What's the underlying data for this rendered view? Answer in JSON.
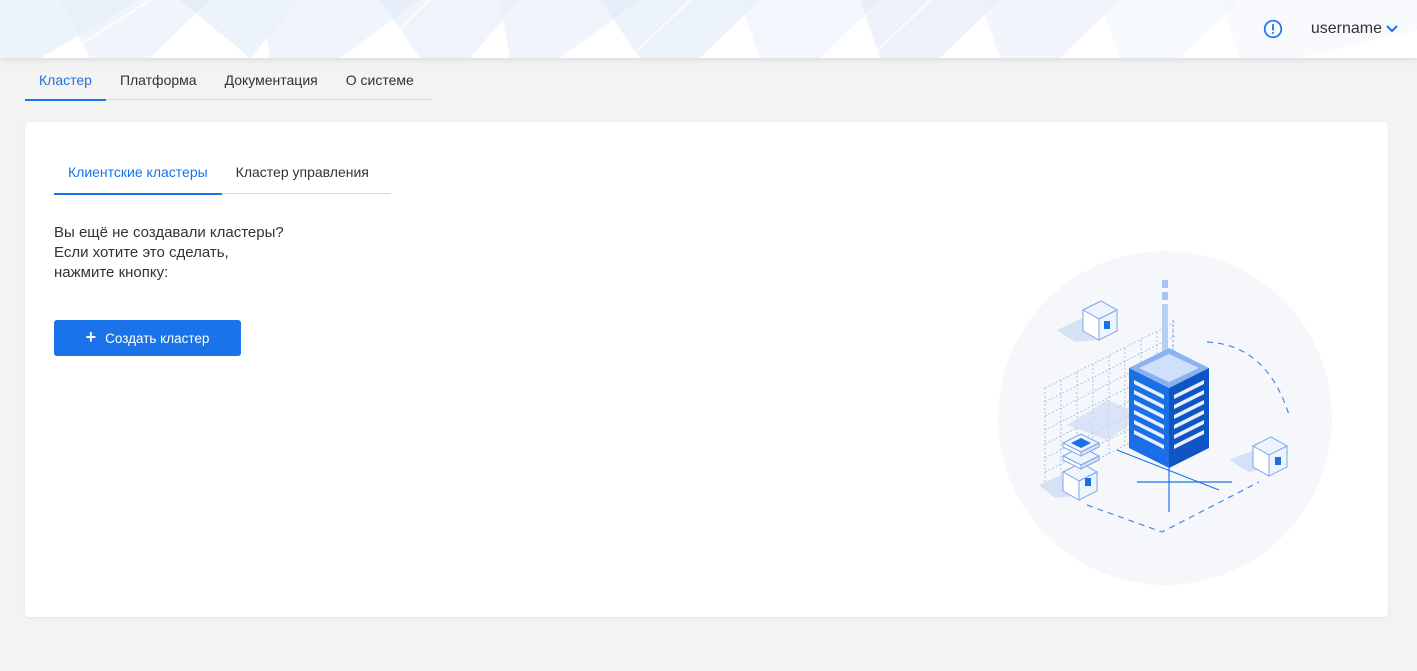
{
  "header": {
    "info_icon": "info-circle-icon",
    "username": "username",
    "chevron_icon": "chevron-down-icon",
    "accent_color": "#1a73e8"
  },
  "topnav": {
    "tabs": [
      {
        "label": "Кластер",
        "active": true
      },
      {
        "label": "Платформа",
        "active": false
      },
      {
        "label": "Документация",
        "active": false
      },
      {
        "label": "О системе",
        "active": false
      }
    ]
  },
  "cluster": {
    "subtabs": [
      {
        "label": "Клиентские кластеры",
        "active": true
      },
      {
        "label": "Кластер управления",
        "active": false
      }
    ],
    "empty_message": {
      "line1": "Вы ещё не создавали кластеры?",
      "line2": "Если хотите это сделать,",
      "line3": "нажмите кнопку:"
    },
    "create_button": {
      "icon": "+",
      "label": "Создать кластер"
    },
    "illustration_icon": "server-cluster-illustration"
  }
}
